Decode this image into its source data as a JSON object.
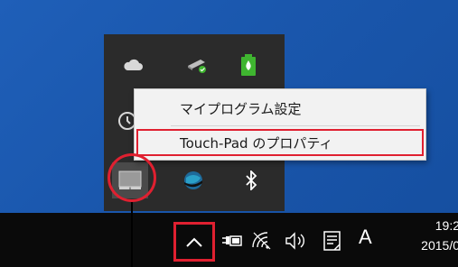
{
  "context_menu": {
    "items": [
      {
        "label": "マイプログラム設定"
      },
      {
        "label": "Touch-Pad のプロパティ"
      }
    ]
  },
  "tray_flyout": {
    "icons": [
      {
        "name": "onedrive-cloud-icon"
      },
      {
        "name": "removable-drive-icon"
      },
      {
        "name": "battery-manager-icon"
      },
      {
        "name": "clock-utility-icon"
      },
      {
        "name": "touchpad-icon"
      },
      {
        "name": "globe-network-icon"
      },
      {
        "name": "bluetooth-icon"
      }
    ]
  },
  "taskbar": {
    "ime_mode": "A",
    "clock_time": "19:2",
    "clock_date": "2015/0"
  },
  "colors": {
    "highlight": "#e02030",
    "desktop": "#1a57ad",
    "flyout": "#2b2b2b",
    "taskbar": "#0a0a0a",
    "battery_green": "#3fb530"
  }
}
